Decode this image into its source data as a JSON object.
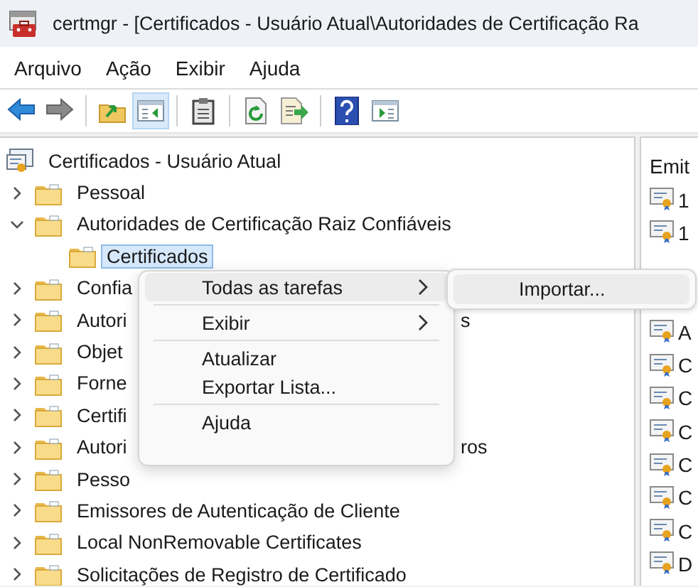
{
  "window": {
    "title": "certmgr - [Certificados - Usuário Atual\\Autoridades de Certificação Ra"
  },
  "menu_bar": [
    "Arquivo",
    "Ação",
    "Exibir",
    "Ajuda"
  ],
  "toolbar": [
    {
      "kind": "back",
      "pressed": false
    },
    {
      "kind": "forward",
      "pressed": false
    },
    {
      "kind": "separator"
    },
    {
      "kind": "up",
      "pressed": false
    },
    {
      "kind": "tree_toggle",
      "pressed": true
    },
    {
      "kind": "separator"
    },
    {
      "kind": "clipboard",
      "pressed": false
    },
    {
      "kind": "separator"
    },
    {
      "kind": "refresh",
      "pressed": false
    },
    {
      "kind": "export",
      "pressed": false
    },
    {
      "kind": "separator"
    },
    {
      "kind": "help",
      "pressed": false
    },
    {
      "kind": "action_pane",
      "pressed": false
    }
  ],
  "tree": {
    "kind": "store",
    "label": "Certificados - Usuário Atual",
    "selected": false,
    "children": [
      {
        "kind": "folder",
        "label": "Pessoal",
        "expanded": false,
        "selected": false
      },
      {
        "kind": "folder",
        "label": "Autoridades de Certificação Raiz Confiáveis",
        "expanded": true,
        "selected": false,
        "children": [
          {
            "kind": "folder",
            "label": "Certificados",
            "selected": true
          }
        ]
      },
      {
        "kind": "folder",
        "label": "Confia",
        "expanded": false,
        "selected": false
      },
      {
        "kind": "folder",
        "label": "Autori",
        "tail": "s",
        "expanded": false,
        "selected": false
      },
      {
        "kind": "folder",
        "label": "Objet",
        "expanded": false,
        "selected": false
      },
      {
        "kind": "folder",
        "label": "Forne",
        "expanded": false,
        "selected": false
      },
      {
        "kind": "folder",
        "label": "Certifi",
        "expanded": false,
        "selected": false
      },
      {
        "kind": "folder",
        "label": "Autori",
        "tail": "ros",
        "expanded": false,
        "selected": false
      },
      {
        "kind": "folder",
        "label": "Pesso",
        "expanded": false,
        "selected": false
      },
      {
        "kind": "folder",
        "label": "Emissores de Autenticação de Cliente",
        "expanded": false,
        "selected": false
      },
      {
        "kind": "folder",
        "label": "Local NonRemovable Certificates",
        "expanded": false,
        "selected": false
      },
      {
        "kind": "folder",
        "label": "Solicitações de Registro de Certificado",
        "expanded": false,
        "selected": false
      }
    ]
  },
  "list": {
    "column_1": "Emit",
    "rows": [
      "1",
      "1",
      "A",
      "C",
      "C",
      "C",
      "C",
      "C",
      "C",
      "D"
    ]
  },
  "context_menu": [
    {
      "kind": "submenu",
      "label": "Todas as tarefas",
      "selected": true
    },
    {
      "kind": "separator"
    },
    {
      "kind": "submenu",
      "label": "Exibir",
      "selected": false
    },
    {
      "kind": "separator"
    },
    {
      "kind": "command",
      "label": "Atualizar",
      "selected": false
    },
    {
      "kind": "command",
      "label": "Exportar Lista...",
      "selected": false
    },
    {
      "kind": "separator"
    },
    {
      "kind": "command",
      "label": "Ajuda",
      "selected": false
    }
  ],
  "submenu": [
    {
      "kind": "command",
      "label": "Importar...",
      "selected": true
    }
  ]
}
